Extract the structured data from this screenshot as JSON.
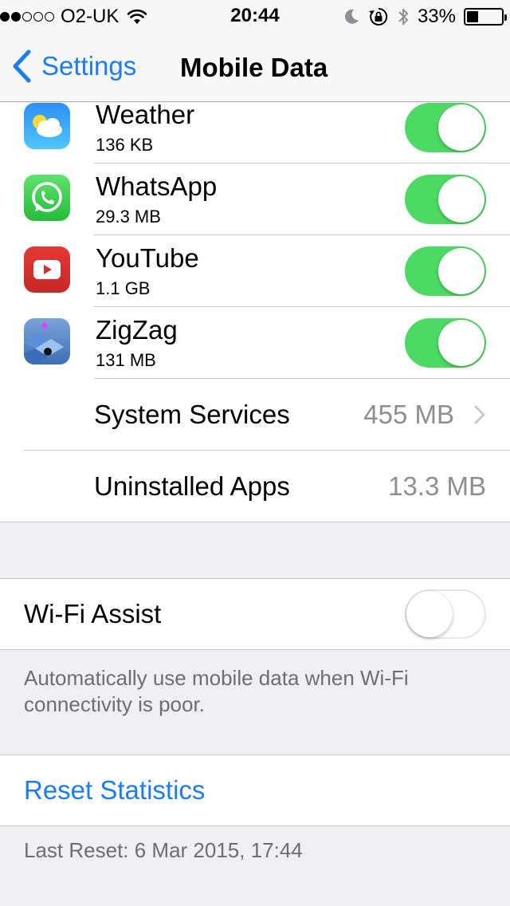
{
  "status": {
    "carrier": "O2-UK",
    "signal_filled": 2,
    "signal_total": 5,
    "time": "20:44",
    "battery": "33%",
    "battery_level": 0.33
  },
  "nav": {
    "back_label": "Settings",
    "title": "Mobile Data"
  },
  "apps": [
    {
      "name": "Weather",
      "usage": "136 KB",
      "enabled": true,
      "icon": "weather-icon"
    },
    {
      "name": "WhatsApp",
      "usage": "29.3 MB",
      "enabled": true,
      "icon": "whatsapp-icon"
    },
    {
      "name": "YouTube",
      "usage": "1.1 GB",
      "enabled": true,
      "icon": "youtube-icon"
    },
    {
      "name": "ZigZag",
      "usage": "131 MB",
      "enabled": true,
      "icon": "zigzag-icon"
    }
  ],
  "system_services": {
    "label": "System Services",
    "value": "455 MB"
  },
  "uninstalled_apps": {
    "label": "Uninstalled Apps",
    "value": "13.3 MB"
  },
  "wifi_assist": {
    "label": "Wi-Fi Assist",
    "enabled": false,
    "description": "Automatically use mobile data when Wi-Fi connectivity is poor."
  },
  "reset": {
    "label": "Reset Statistics",
    "last_reset": "Last Reset: 6 Mar 2015, 17:44"
  },
  "colors": {
    "accent": "#1c7cf4",
    "toggle_on": "#4cd964",
    "background": "#efeff4"
  }
}
